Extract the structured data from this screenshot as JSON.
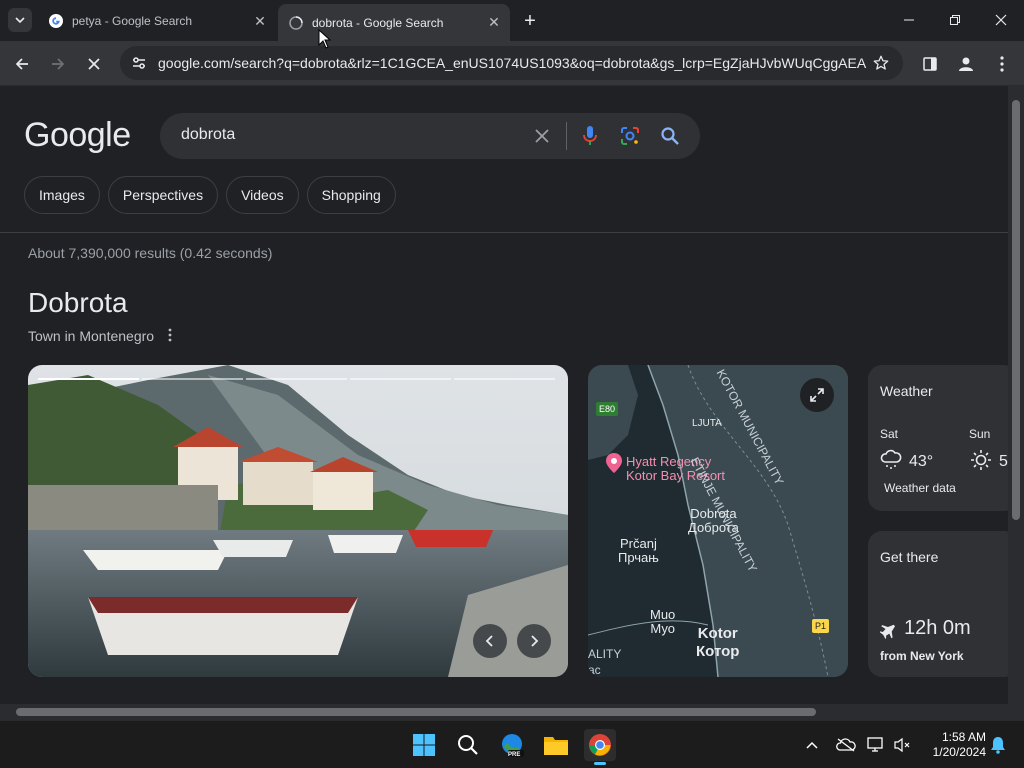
{
  "browser": {
    "tabs": [
      {
        "title": "petya - Google Search",
        "active": false
      },
      {
        "title": "dobrota - Google Search",
        "active": true
      }
    ],
    "url": "google.com/search?q=dobrota&rlz=1C1GCEA_enUS1074US1093&oq=dobrota&gs_lcrp=EgZjaHJvbWUqCggAEA..."
  },
  "search": {
    "logo": "Google",
    "query": "dobrota",
    "chips": [
      "Images",
      "Perspectives",
      "Videos",
      "Shopping"
    ],
    "stats": "About 7,390,000 results (0.42 seconds)"
  },
  "knowledge_panel": {
    "title": "Dobrota",
    "subtitle": "Town in Montenegro",
    "map": {
      "labels": {
        "e80": "E80",
        "ljuta": "LJUTA",
        "hotel": "Hyatt Regency\nKotor Bay Resort",
        "dobrota": "Dobrota\nДоброта",
        "prcanj": "Prčanj\nПрчањ",
        "muo": "Muo\nМуо",
        "kotor": "Kotor\nКотор",
        "p1": "P1",
        "cetinje_muni": "ETINJE MUNICIPALITY",
        "kotor_muni": "KOTOR MUNICIPALITY",
        "ality": "ALITY",
        "bac": "ac"
      }
    },
    "weather": {
      "heading": "Weather",
      "days": [
        {
          "day": "Sat",
          "temp": "43°",
          "icon": "snow-cloud-icon"
        },
        {
          "day": "Sun",
          "temp": "5",
          "icon": "sun-icon"
        }
      ],
      "source": "Weather data"
    },
    "get_there": {
      "heading": "Get there",
      "duration": "12h 0m",
      "from": "from New York"
    }
  },
  "taskbar": {
    "time": "1:58 AM",
    "date": "1/20/2024",
    "edge_badge": "PRE"
  },
  "colors": {
    "page_bg": "#202124",
    "chrome_bg": "#35363a",
    "search_bg": "#303134",
    "accent_blue": "#8ab4f8",
    "hotel_pin": "#f06292"
  }
}
